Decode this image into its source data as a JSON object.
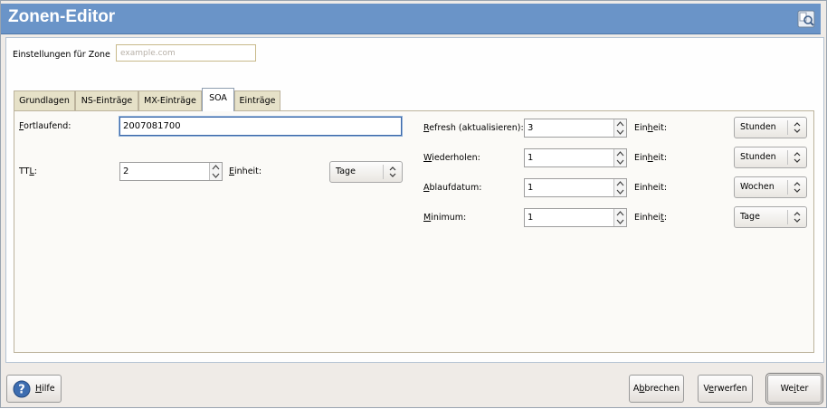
{
  "window": {
    "title": "Zonen-Editor",
    "icon": "dns-zone-icon"
  },
  "zone": {
    "label": "Einstellungen für Zone",
    "placeholder": "example.com"
  },
  "tabs": [
    {
      "label": "Grundlagen",
      "active": false
    },
    {
      "label": "NS-Einträge",
      "active": false
    },
    {
      "label": "MX-Einträge",
      "active": false
    },
    {
      "label": "SOA",
      "active": true
    },
    {
      "label": "Einträge",
      "active": false
    }
  ],
  "soa": {
    "serial": {
      "label_u": "F",
      "label_rest": "ortlaufend:",
      "value": "2007081700"
    },
    "ttl": {
      "label_pre": "TT",
      "label_u": "L",
      "label_post": ":",
      "value": "2",
      "unit_label_u": "E",
      "unit_label_rest": "inheit:",
      "unit": "Tage"
    },
    "refresh": {
      "label_u": "R",
      "label_rest": "efresh (aktualisieren):",
      "value": "3",
      "unit_label_pre": "Ein",
      "unit_label_u": "h",
      "unit_label_post": "eit:",
      "unit": "Stunden"
    },
    "retry": {
      "label_u": "W",
      "label_rest": "iederholen:",
      "value": "1",
      "unit_label_pre": "Ein",
      "unit_label_u": "h",
      "unit_label_post": "eit:",
      "unit": "Stunden"
    },
    "expire": {
      "label_u": "A",
      "label_rest": "blaufdatum:",
      "value": "1",
      "unit_label": "Einheit:",
      "unit": "Wochen"
    },
    "minimum": {
      "label_u": "M",
      "label_rest": "inimum:",
      "value": "1",
      "unit_label_pre": "Einhei",
      "unit_label_u": "t",
      "unit_label_post": ":",
      "unit": "Tage"
    }
  },
  "footer": {
    "help": {
      "label_u": "H",
      "label_rest": "ilfe"
    },
    "abort": {
      "label_pre": "A",
      "label_u": "b",
      "label_post": "brechen"
    },
    "discard": {
      "label_pre": "V",
      "label_u": "e",
      "label_post": "rwerfen"
    },
    "next": {
      "label_pre": "We",
      "label_u": "i",
      "label_post": "ter"
    }
  },
  "colors": {
    "titlebar": "#6a94c8",
    "accent_focus": "#3b67a8"
  }
}
